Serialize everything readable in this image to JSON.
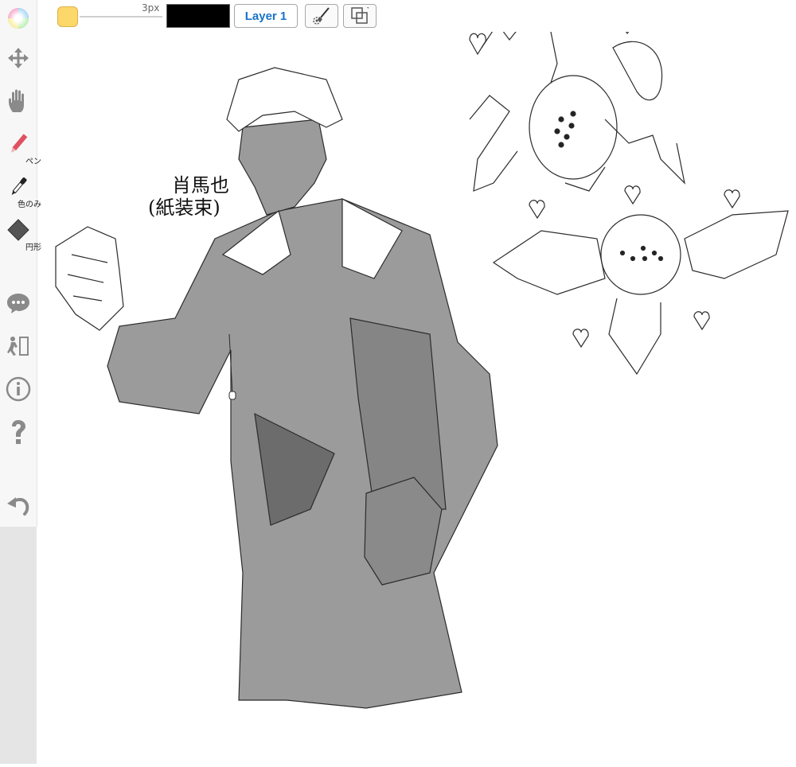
{
  "toolbar": {
    "tools": [
      {
        "name": "color-wheel",
        "label": ""
      },
      {
        "name": "move",
        "label": ""
      },
      {
        "name": "hand",
        "label": ""
      },
      {
        "name": "pen",
        "label": "ペン"
      },
      {
        "name": "eyedropper",
        "label": "色のみ"
      },
      {
        "name": "shape",
        "label": "円形"
      },
      {
        "name": "chat",
        "label": ""
      },
      {
        "name": "exit",
        "label": ""
      },
      {
        "name": "info",
        "label": ""
      },
      {
        "name": "help",
        "label": ""
      },
      {
        "name": "undo",
        "label": ""
      }
    ]
  },
  "topbar": {
    "brush_size_label": "3px",
    "current_color": "#fcd76a",
    "stroke_color": "#000000",
    "layer_label": "Layer 1",
    "layer_settings_icon": "brush-gear-icon",
    "transform_icon": "transform-icon"
  },
  "canvas": {
    "label_line1": "肖馬也",
    "label_line2": "(紙装束)"
  },
  "colors": {
    "sidebar": "#f7f7f7",
    "accent_blue": "#1a73c8",
    "gray_tone": "#9a9a9a"
  }
}
